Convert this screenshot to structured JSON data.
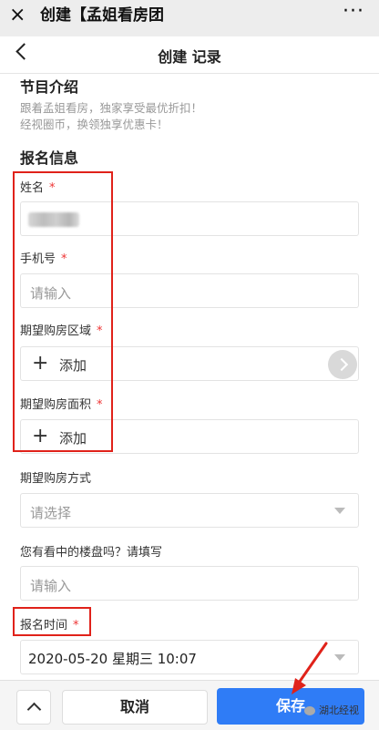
{
  "window": {
    "title": "创建【孟姐看房团",
    "close_icon": "×",
    "more_icon": "···"
  },
  "header": {
    "title": "创建 记录"
  },
  "section_intro": {
    "title": "节目介绍",
    "desc_line1": "跟着孟姐看房，独家享受最优折扣！",
    "desc_line2": "经视圈币，换领独享优惠卡！"
  },
  "section_signup": {
    "title": "报名信息"
  },
  "fields": {
    "name": {
      "label": "姓名",
      "required": "*"
    },
    "phone": {
      "label": "手机号",
      "required": "*",
      "placeholder": "请输入"
    },
    "area": {
      "label": "期望购房区域",
      "required": "*",
      "add_icon": "+",
      "add_text": "添加"
    },
    "size": {
      "label": "期望购房面积",
      "required": "*",
      "add_icon": "+",
      "add_text": "添加"
    },
    "method": {
      "label": "期望购房方式",
      "placeholder": "请选择"
    },
    "building": {
      "label": "您有看中的楼盘吗？请填写",
      "placeholder": "请输入"
    },
    "time": {
      "label": "报名时间",
      "required": "*",
      "value": "2020-05-20 星期三 10:07"
    }
  },
  "footer": {
    "cancel_label": "取消",
    "save_label": "保存"
  },
  "watermark": "湖北经视",
  "colors": {
    "accent": "#2f7cf6",
    "annotation": "#e0221a",
    "required": "#ee3333"
  },
  "icons": [
    "close-icon",
    "more-icon",
    "back-chevron-icon",
    "plus-icon",
    "chevron-right-icon",
    "caret-down-icon",
    "chevron-up-icon"
  ]
}
